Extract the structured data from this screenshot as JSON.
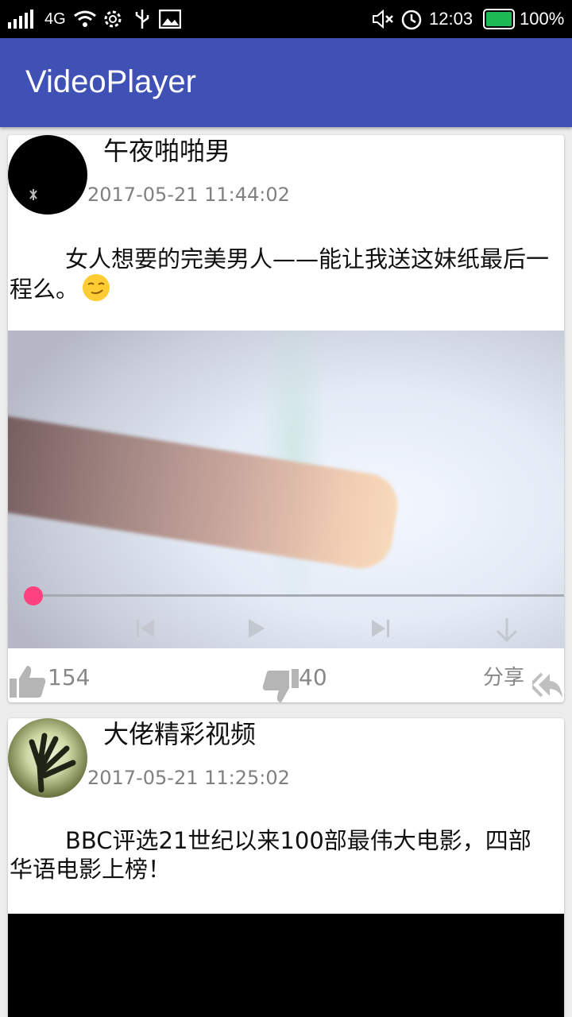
{
  "status_bar": {
    "network": "4G",
    "time": "12:03",
    "battery": "100%",
    "icons": [
      "signal-icon",
      "wifi-icon",
      "settings-icon",
      "usb-icon",
      "image-icon",
      "mute-icon",
      "alarm-icon",
      "battery-icon"
    ]
  },
  "app_bar": {
    "title": "VideoPlayer"
  },
  "colors": {
    "app_bar": "#3f51b5",
    "seek_thumb": "#ff4081"
  },
  "posts": [
    {
      "author": "午夜啪啪男",
      "time": "2017-05-21 11:44:02",
      "text": "女人想要的完美男人——能让我送这妹纸最后一程么。",
      "emoji": "smirk-emoji",
      "video": {
        "progress": 0,
        "controls": [
          "previous-icon",
          "play-icon",
          "next-icon",
          "download-icon"
        ]
      },
      "likes": "154",
      "dislikes": "40",
      "share_label": "分享"
    },
    {
      "author": "大佬精彩视频",
      "time": "2017-05-21 11:25:02",
      "text": "BBC评选21世纪以来100部最伟大电影，四部华语电影上榜！"
    }
  ]
}
